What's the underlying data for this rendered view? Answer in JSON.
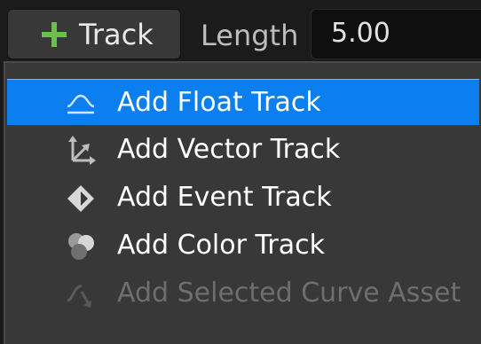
{
  "toolbar": {
    "track_button_label": "Track",
    "length_label": "Length",
    "length_value": "5.00"
  },
  "menu": {
    "items": [
      {
        "label": "Add Float Track",
        "icon": "float-track-icon",
        "selected": true,
        "enabled": true
      },
      {
        "label": "Add Vector Track",
        "icon": "vector-track-icon",
        "selected": false,
        "enabled": true
      },
      {
        "label": "Add Event Track",
        "icon": "event-track-icon",
        "selected": false,
        "enabled": true
      },
      {
        "label": "Add Color Track",
        "icon": "color-track-icon",
        "selected": false,
        "enabled": true
      },
      {
        "label": "Add Selected Curve Asset",
        "icon": "curve-asset-icon",
        "selected": false,
        "enabled": false
      }
    ]
  },
  "colors": {
    "accent": "#0b7ef0",
    "plus": "#6cc04a",
    "menu_bg": "#383838",
    "disabled_text": "#6e6e6e"
  }
}
